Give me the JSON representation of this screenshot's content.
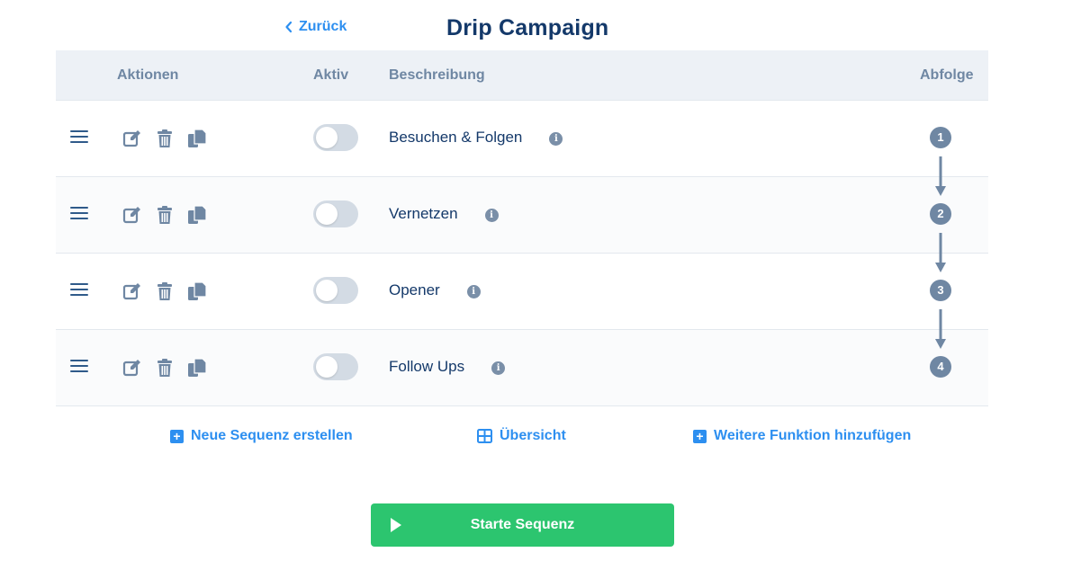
{
  "header": {
    "back_label": "Zurück",
    "title": "Drip Campaign"
  },
  "table": {
    "columns": {
      "actions": "Aktionen",
      "active": "Aktiv",
      "description": "Beschreibung",
      "sequence": "Abfolge"
    },
    "rows": [
      {
        "description": "Besuchen & Folgen",
        "active": false,
        "order": "1"
      },
      {
        "description": "Vernetzen",
        "active": false,
        "order": "2"
      },
      {
        "description": "Opener",
        "active": false,
        "order": "3"
      },
      {
        "description": "Follow Ups",
        "active": false,
        "order": "4"
      }
    ]
  },
  "footer": {
    "new_sequence": "Neue Sequenz erstellen",
    "overview": "Übersicht",
    "add_function": "Weitere Funktion hinzufügen"
  },
  "start_button": "Starte Sequenz",
  "icons": {
    "back": "chevron-left-icon",
    "drag": "drag-handle-icon",
    "edit": "edit-icon",
    "delete": "trash-icon",
    "copy": "copy-icon",
    "info": "info-icon",
    "plus": "plus-square-icon",
    "grid": "grid-icon",
    "play": "play-icon",
    "arrow": "arrow-down-icon"
  },
  "colors": {
    "primary": "#2d8ff0",
    "title": "#14396a",
    "header_bg": "#edf1f6",
    "muted": "#6f87a3",
    "toggle_off": "#d3dbe4",
    "start_green": "#2cc56f"
  }
}
